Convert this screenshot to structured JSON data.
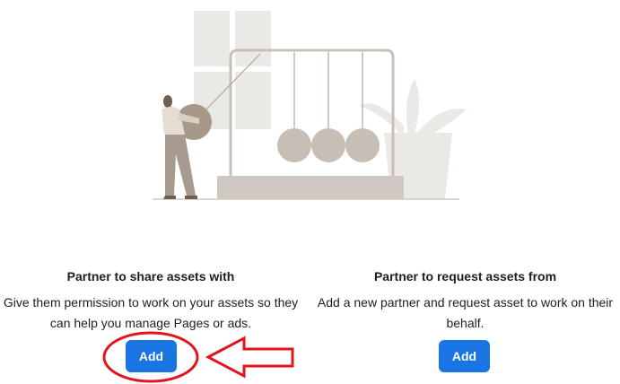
{
  "share_assets": {
    "title": "Partner to share assets with",
    "description": "Give them permission to work on your assets so they can help you manage Pages or ads.",
    "button_label": "Add"
  },
  "request_assets": {
    "title": "Partner to request assets from",
    "description": "Add a new partner and request asset to work on their behalf.",
    "button_label": "Add"
  },
  "colors": {
    "button": "#1b74e4",
    "annotation": "#e0161e"
  },
  "icons": [
    "newtons-cradle-illustration",
    "annotation-circle",
    "annotation-arrow"
  ]
}
